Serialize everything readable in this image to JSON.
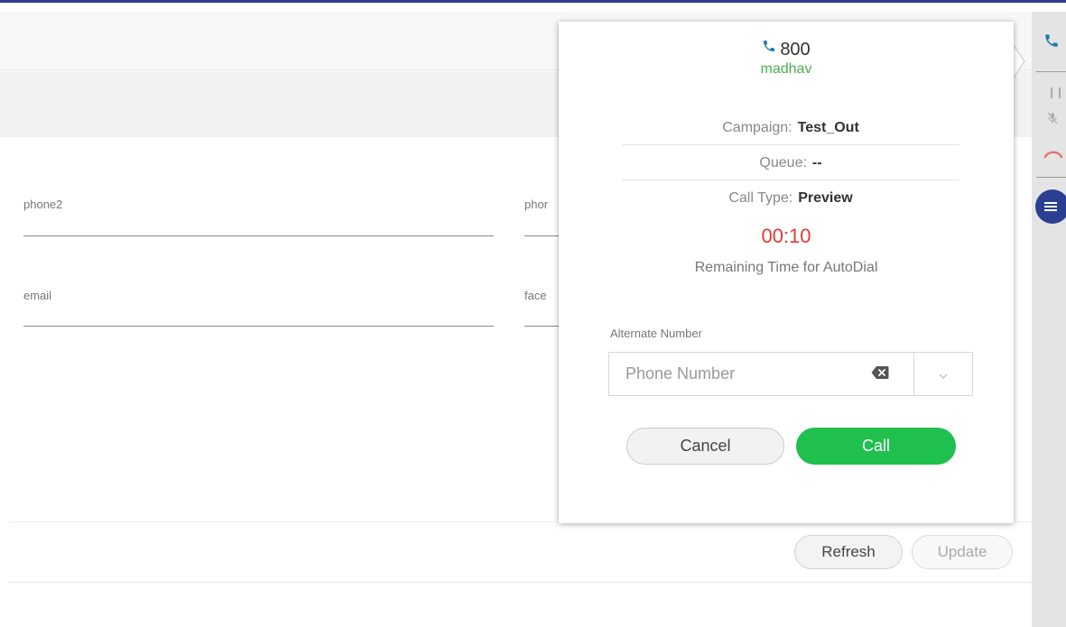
{
  "form": {
    "phone2_label": "phone2",
    "phone3_label_partial": "phor",
    "email_label": "email",
    "facebook_label_partial": "face"
  },
  "footer": {
    "refresh_label": "Refresh",
    "update_label": "Update"
  },
  "call_popup": {
    "number": "800",
    "contact_name": "madhav",
    "campaign_label": "Campaign:",
    "campaign_value": "Test_Out",
    "queue_label": "Queue:",
    "queue_value": "--",
    "call_type_label": "Call Type:",
    "call_type_value": "Preview",
    "timer": "00:10",
    "timer_caption": "Remaining Time for AutoDial",
    "alternate_label": "Alternate Number",
    "phone_placeholder": "Phone Number",
    "cancel_label": "Cancel",
    "call_label": "Call"
  },
  "icons": {
    "popup_phone": "phone-icon",
    "rail_phone": "phone-icon",
    "pause": "pause-icon",
    "mute": "mute-icon",
    "hangup": "hangup-icon",
    "menu": "menu-icon",
    "clear": "backspace-icon",
    "dropdown": "chevron-down-icon"
  },
  "colors": {
    "accent_blue": "#2b3f92",
    "phone_icon": "#1a7ea8",
    "contact_name": "#4cb050",
    "timer": "#e53935",
    "call_button": "#1fc04e",
    "hangup": "#e57373"
  }
}
